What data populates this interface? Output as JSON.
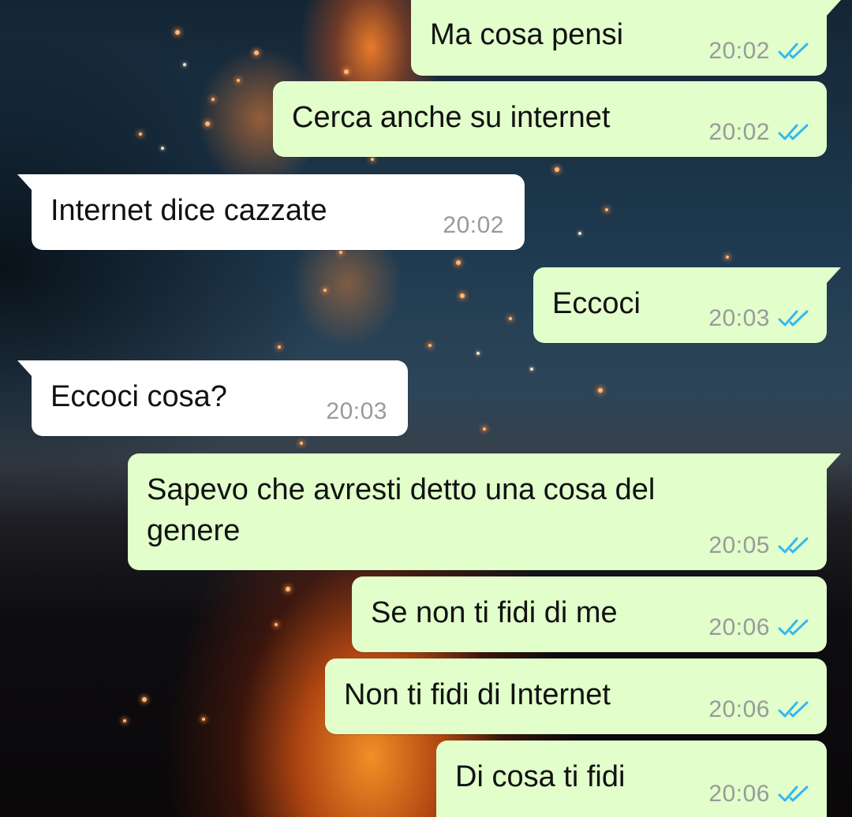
{
  "chat": {
    "messages": [
      {
        "direction": "out",
        "text": "Ma cosa pensi",
        "time": "20:02",
        "status": "read"
      },
      {
        "direction": "out",
        "text": "Cerca anche su internet",
        "time": "20:02",
        "status": "read"
      },
      {
        "direction": "in",
        "text": "Internet dice cazzate",
        "time": "20:02"
      },
      {
        "direction": "out",
        "text": "Eccoci",
        "time": "20:03",
        "status": "read"
      },
      {
        "direction": "in",
        "text": "Eccoci cosa?",
        "time": "20:03"
      },
      {
        "direction": "out",
        "text": "Sapevo che avresti detto una cosa del\ngenere",
        "time": "20:05",
        "status": "read"
      },
      {
        "direction": "out",
        "text": "Se non ti fidi di me",
        "time": "20:06",
        "status": "read"
      },
      {
        "direction": "out",
        "text": "Non ti fidi di Internet",
        "time": "20:06",
        "status": "read"
      },
      {
        "direction": "out",
        "text": "Di cosa ti fidi",
        "time": "20:06",
        "status": "read"
      }
    ]
  },
  "colors": {
    "outgoing_bubble": "#e1fecb",
    "incoming_bubble": "#ffffff",
    "read_ticks": "#34b7f1",
    "timestamp": "#9a9a9a"
  },
  "icons": {
    "read_receipt": "double-check-icon"
  }
}
